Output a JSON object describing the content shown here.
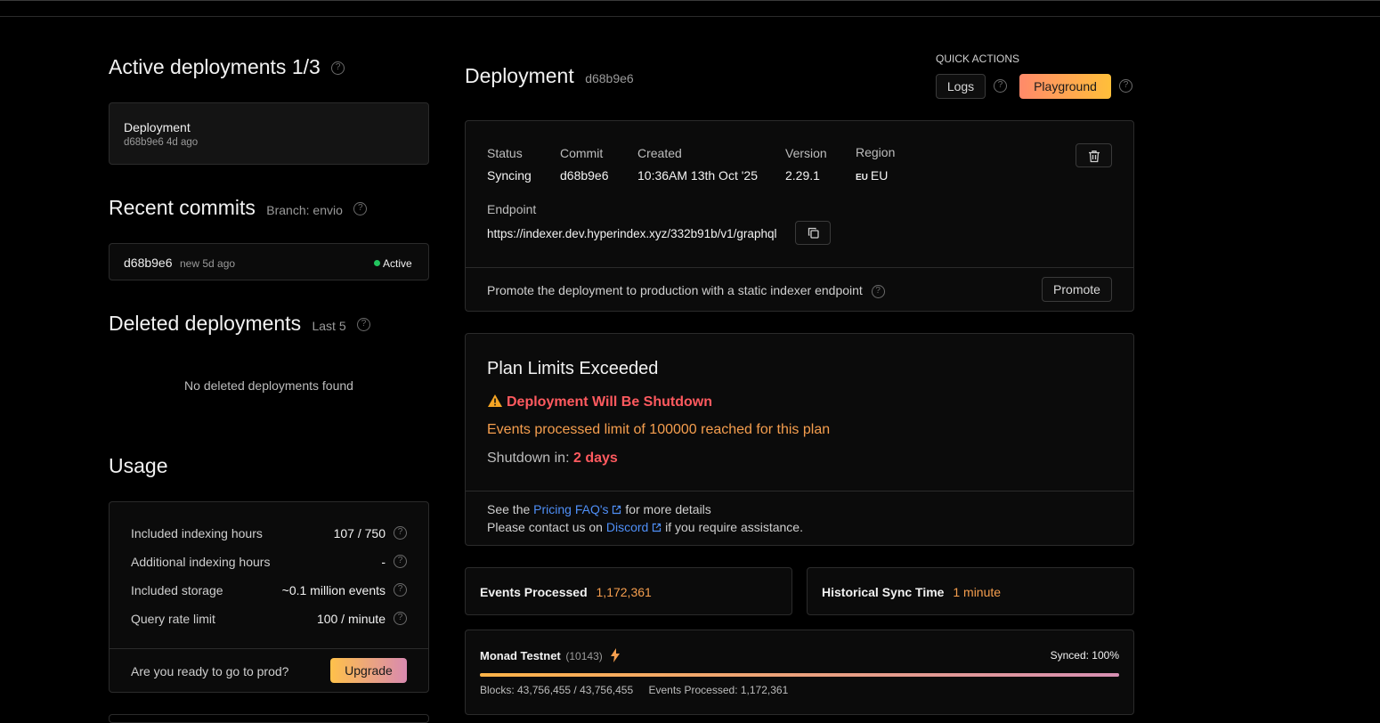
{
  "left": {
    "active": {
      "title": "Active deployments",
      "count": "1/3",
      "item": {
        "name": "Deployment",
        "meta": "d68b9e6 4d ago"
      }
    },
    "commits": {
      "title": "Recent commits",
      "branch": "Branch: envio",
      "item": {
        "hash": "d68b9e6",
        "meta": "new 5d ago",
        "status": "Active"
      }
    },
    "deleted": {
      "title": "Deleted deployments",
      "sub": "Last 5",
      "empty": "No deleted deployments found"
    },
    "usage": {
      "title": "Usage",
      "rows": [
        {
          "label": "Included indexing hours",
          "value": "107 / 750"
        },
        {
          "label": "Additional indexing hours",
          "value": "-"
        },
        {
          "label": "Included storage",
          "value": "~0.1 million events"
        },
        {
          "label": "Query rate limit",
          "value": "100 / minute"
        }
      ],
      "prompt": "Are you ready to go to prod?",
      "upgrade": "Upgrade"
    }
  },
  "main": {
    "title": "Deployment",
    "hash": "d68b9e6",
    "quick_actions": {
      "label": "QUICK ACTIONS",
      "logs": "Logs",
      "playground": "Playground"
    },
    "info": {
      "status_label": "Status",
      "status": "Syncing",
      "commit_label": "Commit",
      "commit": "d68b9e6",
      "created_label": "Created",
      "created": "10:36AM 13th Oct '25",
      "version_label": "Version",
      "version": "2.29.1",
      "region_label": "Region",
      "region_code": "EU",
      "region": "EU",
      "endpoint_label": "Endpoint",
      "endpoint": "https://indexer.dev.hyperindex.xyz/332b91b/v1/graphql",
      "promote_text": "Promote the deployment to production with a static indexer endpoint",
      "promote_btn": "Promote"
    },
    "limits": {
      "title": "Plan Limits Exceeded",
      "warning": "Deployment Will Be Shutdown",
      "message": "Events processed limit of 100000 reached for this plan",
      "shutdown_label": "Shutdown in:",
      "shutdown_value": "2 days",
      "faq_pre": "See the",
      "faq_link": "Pricing FAQ's",
      "faq_post": "for more details",
      "contact_pre": "Please contact us on",
      "contact_link": "Discord",
      "contact_post": "if you require assistance."
    },
    "stats": {
      "events_label": "Events Processed",
      "events_value": "1,172,361",
      "sync_label": "Historical Sync Time",
      "sync_value": "1 minute"
    },
    "chain": {
      "name": "Monad Testnet",
      "id": "(10143)",
      "synced": "Synced: 100%",
      "progress": 1.0,
      "blocks": "Blocks: 43,756,455 / 43,756,455",
      "events": "Events Processed: 1,172,361"
    }
  },
  "colors": {
    "accent_orange": "#f59e4e",
    "danger": "#ff5a5f",
    "link": "#4f8ff7",
    "active_dot": "#22c55e"
  }
}
